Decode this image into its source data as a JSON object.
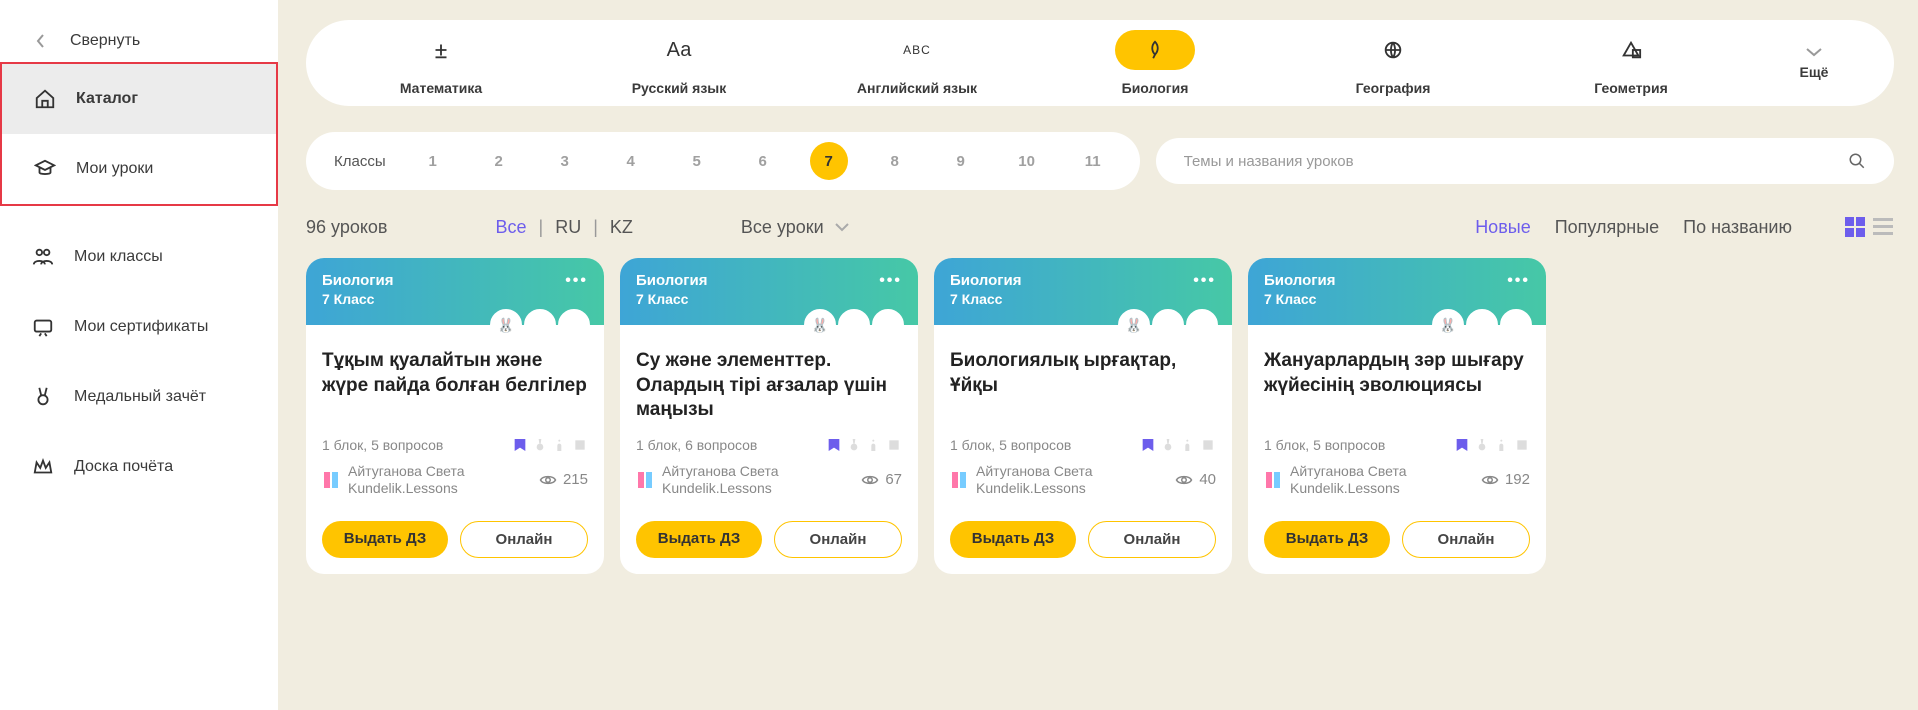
{
  "sidebar": {
    "collapse": "Свернуть",
    "items": [
      {
        "label": "Каталог",
        "icon": "home"
      },
      {
        "label": "Мои уроки",
        "icon": "graduation"
      },
      {
        "label": "Мои классы",
        "icon": "people"
      },
      {
        "label": "Мои сертификаты",
        "icon": "certificate"
      },
      {
        "label": "Медальный зачёт",
        "icon": "medal"
      },
      {
        "label": "Доска почёта",
        "icon": "crown"
      }
    ]
  },
  "subjects": [
    {
      "label": "Математика",
      "icon": "math"
    },
    {
      "label": "Русский язык",
      "icon": "rus"
    },
    {
      "label": "Английский язык",
      "icon": "eng"
    },
    {
      "label": "Биология",
      "icon": "bio",
      "active": true
    },
    {
      "label": "География",
      "icon": "geo"
    },
    {
      "label": "Геометрия",
      "icon": "geom"
    }
  ],
  "more_label": "Ещё",
  "classes": {
    "label": "Классы",
    "items": [
      "1",
      "2",
      "3",
      "4",
      "5",
      "6",
      "7",
      "8",
      "9",
      "10",
      "11"
    ],
    "active": "7"
  },
  "search": {
    "placeholder": "Темы и названия уроков"
  },
  "lesson_count": "96 уроков",
  "lang_filter": {
    "all": "Все",
    "ru": "RU",
    "kz": "KZ"
  },
  "lesson_dropdown": "Все уроки",
  "sort": {
    "new": "Новые",
    "popular": "Популярные",
    "name": "По названию"
  },
  "cards": [
    {
      "subject": "Биология",
      "class": "7 Класс",
      "title": "Тұқым қуалайтын және жүре пайда болған белгілер",
      "meta": "1 блок, 5 вопросов",
      "author_name": "Айтуганова Света",
      "author_sub": "Kundelik.Lessons",
      "views": "215"
    },
    {
      "subject": "Биология",
      "class": "7 Класс",
      "title": "Су және элементтер. Олардың тірі ағзалар үшін маңызы",
      "meta": "1 блок, 6 вопросов",
      "author_name": "Айтуганова Света",
      "author_sub": "Kundelik.Lessons",
      "views": "67"
    },
    {
      "subject": "Биология",
      "class": "7 Класс",
      "title": "Биологиялық ырғақтар, Ұйқы",
      "meta": "1 блок, 5 вопросов",
      "author_name": "Айтуганова Света",
      "author_sub": "Kundelik.Lessons",
      "views": "40"
    },
    {
      "subject": "Биология",
      "class": "7 Класс",
      "title": "Жануарлардың зәр шығару жүйесінің эволюциясы",
      "meta": "1 блок, 5 вопросов",
      "author_name": "Айтуганова Света",
      "author_sub": "Kundelik.Lessons",
      "views": "192"
    }
  ],
  "btn_primary": "Выдать ДЗ",
  "btn_secondary": "Онлайн"
}
